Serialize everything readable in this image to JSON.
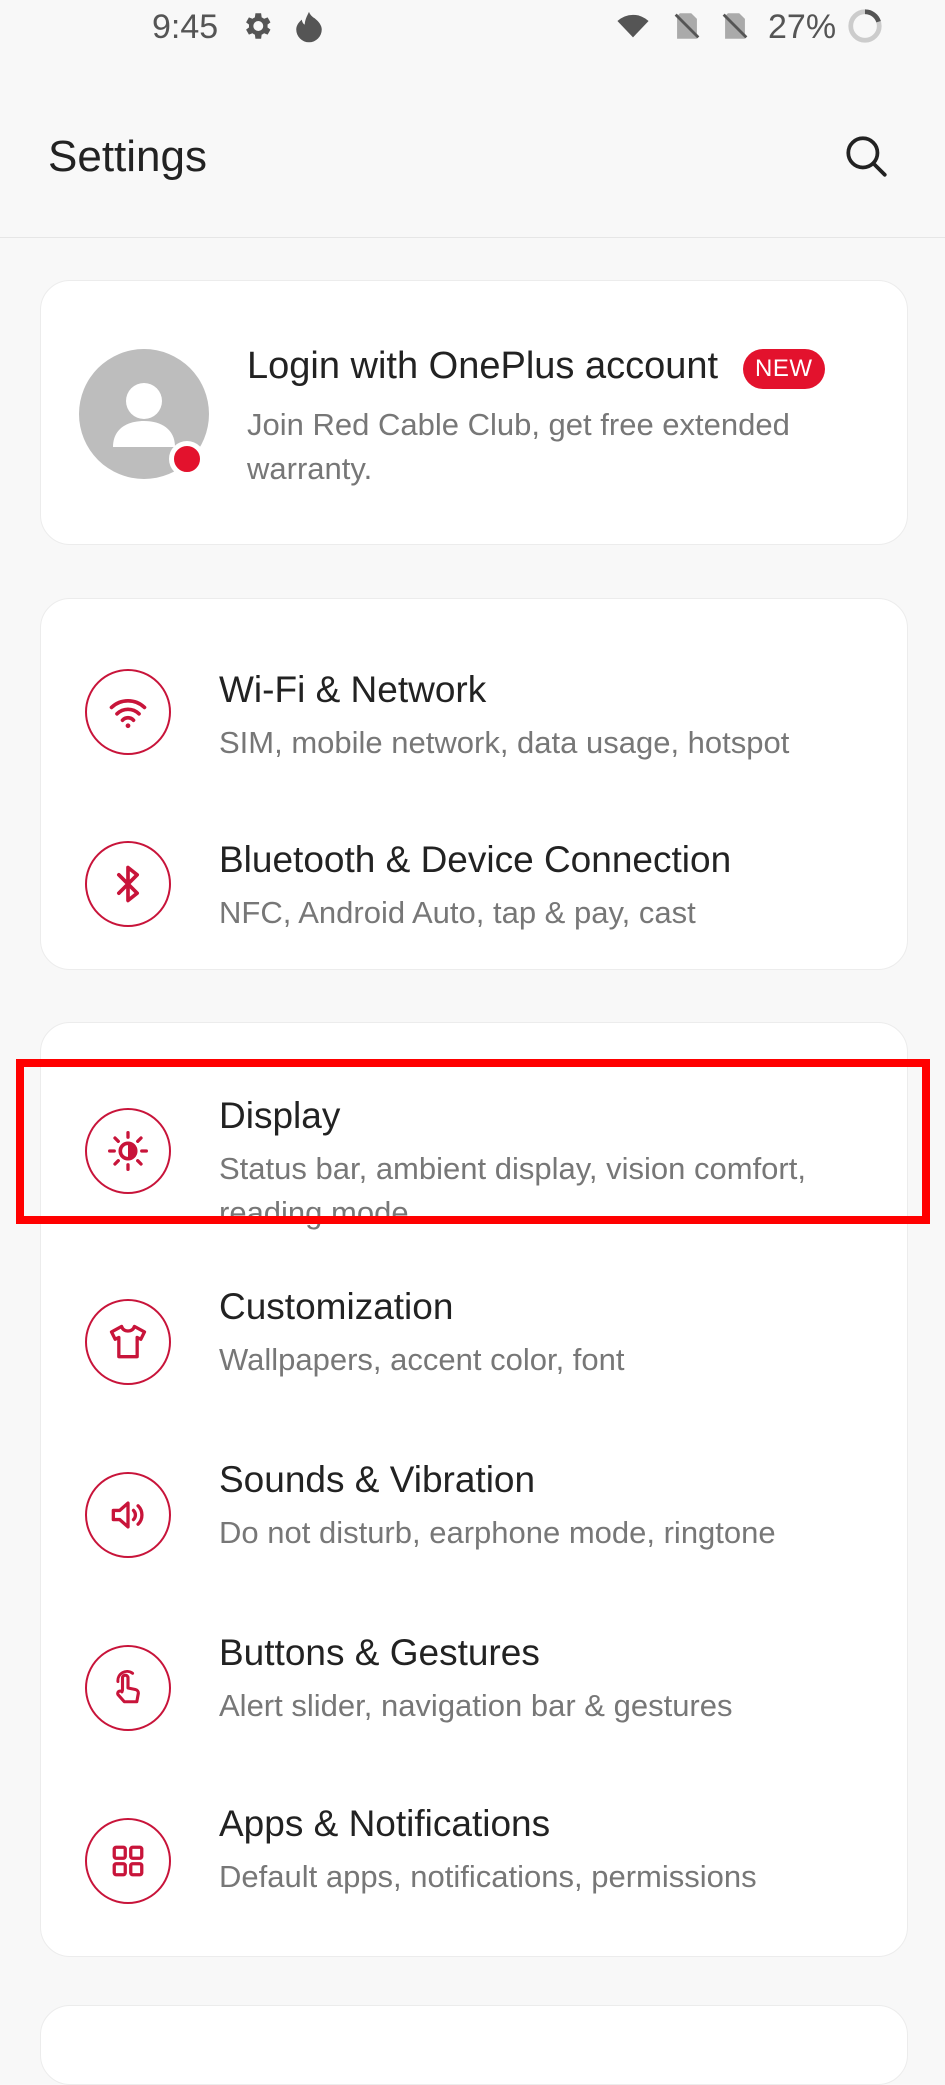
{
  "status_bar": {
    "time": "9:45",
    "battery": "27%",
    "icons": [
      "gear-icon",
      "flame-icon",
      "wifi-icon",
      "no-sim-icon",
      "no-sim-icon",
      "battery-ring-icon"
    ]
  },
  "header": {
    "title": "Settings",
    "search_icon": "search-icon"
  },
  "account": {
    "title": "Login with OnePlus account",
    "badge": "NEW",
    "subtitle": "Join Red Cable Club, get free extended warranty."
  },
  "groups": [
    {
      "items": [
        {
          "title": "Wi-Fi & Network",
          "subtitle": "SIM, mobile network, data usage, hotspot",
          "icon": "wifi-icon"
        },
        {
          "title": "Bluetooth & Device Connection",
          "subtitle": "NFC, Android Auto, tap & pay, cast",
          "icon": "bluetooth-icon"
        }
      ]
    },
    {
      "items": [
        {
          "title": "Display",
          "subtitle": "Status bar, ambient display, vision comfort, reading mode",
          "icon": "brightness-icon"
        },
        {
          "title": "Customization",
          "subtitle": "Wallpapers, accent color, font",
          "icon": "tshirt-icon"
        },
        {
          "title": "Sounds & Vibration",
          "subtitle": "Do not disturb, earphone mode, ringtone",
          "icon": "speaker-icon"
        },
        {
          "title": "Buttons & Gestures",
          "subtitle": "Alert slider, navigation bar & gestures",
          "icon": "gesture-icon"
        },
        {
          "title": "Apps & Notifications",
          "subtitle": "Default apps, notifications, permissions",
          "icon": "apps-grid-icon"
        }
      ]
    }
  ],
  "colors": {
    "accent": "#c8143a",
    "badge": "#e3122d",
    "highlight": "#ff0000"
  }
}
